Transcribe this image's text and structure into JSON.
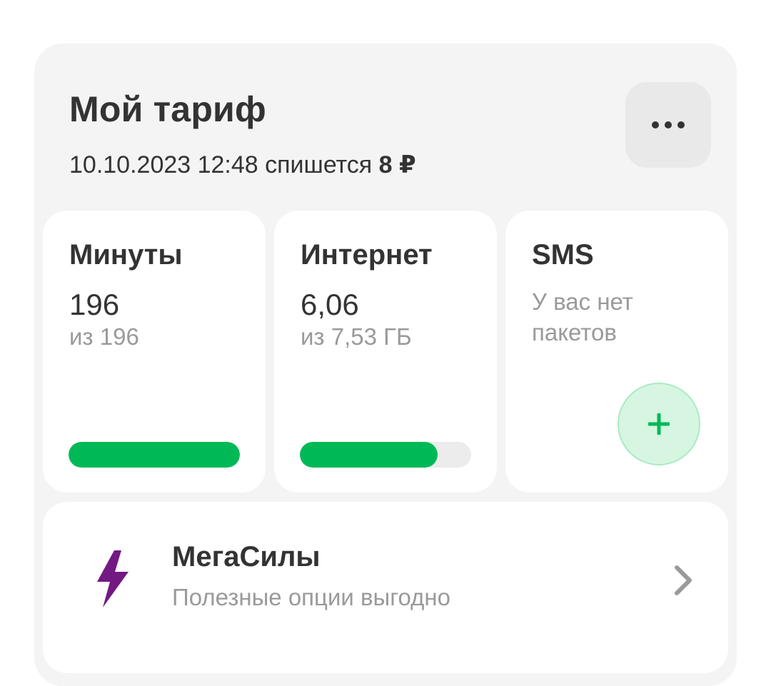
{
  "header": {
    "title": "Мой тариф",
    "charge_date": "10.10.2023 12:48 спишется",
    "charge_amount": "8 ₽",
    "more_icon": "more-horizontal-icon"
  },
  "tiles": {
    "minutes": {
      "title": "Минуты",
      "value": "196",
      "sub": "из 196",
      "progress_fraction": 1.0
    },
    "internet": {
      "title": "Интернет",
      "value": "6,06",
      "sub": "из 7,53 ГБ",
      "progress_fraction": 0.805
    },
    "sms": {
      "title": "SMS",
      "note": "У вас нет пакетов",
      "add_icon": "plus-icon"
    }
  },
  "promo": {
    "title": "МегаСилы",
    "subtitle": "Полезные опции выгодно",
    "icon": "lightning-icon",
    "chevron": "chevron-right-icon"
  },
  "colors": {
    "accent_green": "#00b956",
    "brand_purple": "#731982",
    "card_bg": "#f4f4f4",
    "text_primary": "#333333",
    "text_secondary": "#9a9a9a"
  }
}
